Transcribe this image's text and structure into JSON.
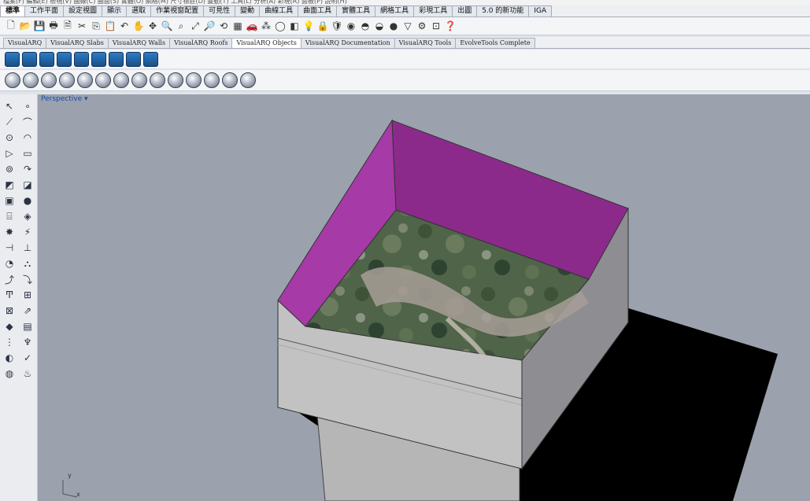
{
  "menubar": {
    "text": "檔案(F)  編輯(E)  檢視(V)  曲線(C)  曲面(S)  實體(O)  網格(M)  尺寸標註(D)  變動(T)  工具(L)  分析(A)  彩現(R)  面板(P)  說明(H)"
  },
  "tabs": [
    "標準",
    "工作平面",
    "設定視圖",
    "顯示",
    "選取",
    "作業視窗配置",
    "可見性",
    "變動",
    "曲線工具",
    "曲面工具",
    "實體工具",
    "網格工具",
    "彩現工具",
    "出圖",
    "5.0 的新功能",
    "IGA"
  ],
  "varq_tabs": [
    "VisualARQ",
    "VisualARQ Slabs",
    "VisualARQ Walls",
    "VisualARQ Roofs",
    "VisualARQ Objects",
    "VisualARQ Documentation",
    "VisualARQ Tools",
    "EvolveTools Complete"
  ],
  "viewport": {
    "label": "Perspective ▾",
    "axis_x": "x",
    "axis_y": "y"
  }
}
